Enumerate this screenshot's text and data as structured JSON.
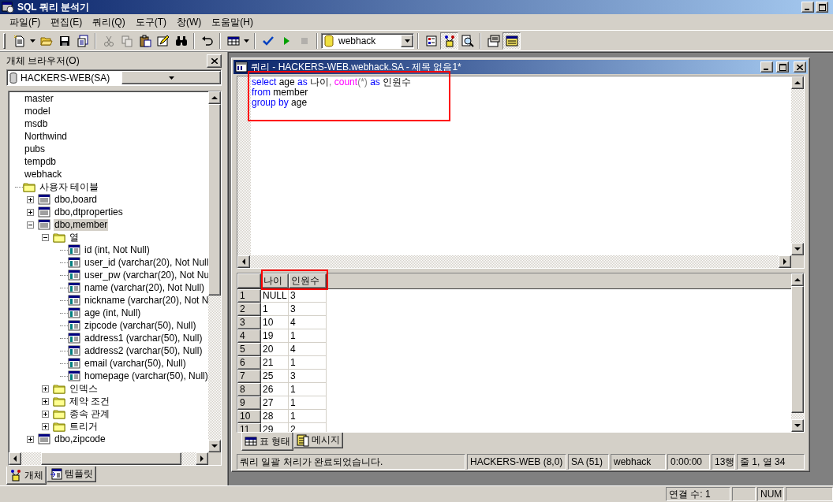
{
  "window": {
    "title": "SQL 쿼리 분석기"
  },
  "menu": [
    "파일(F)",
    "편집(E)",
    "쿼리(Q)",
    "도구(T)",
    "창(W)",
    "도움말(H)"
  ],
  "toolbar": {
    "groups": [
      [
        {
          "kind": "new-query",
          "disabled": false
        },
        {
          "kind": "caret",
          "disabled": false
        },
        {
          "kind": "open",
          "disabled": false
        },
        {
          "kind": "save",
          "disabled": false
        },
        {
          "kind": "load-script",
          "disabled": false
        }
      ],
      [
        {
          "kind": "cut",
          "disabled": true
        },
        {
          "kind": "copy",
          "disabled": true
        },
        {
          "kind": "paste",
          "disabled": false
        },
        {
          "kind": "template",
          "disabled": false
        },
        {
          "kind": "find",
          "disabled": false
        }
      ],
      [
        {
          "kind": "undo",
          "disabled": false
        }
      ],
      [
        {
          "kind": "grid",
          "disabled": false
        },
        {
          "kind": "caret",
          "disabled": false
        }
      ],
      [
        {
          "kind": "check",
          "disabled": false
        },
        {
          "kind": "play",
          "disabled": false
        },
        {
          "kind": "stop",
          "disabled": true
        }
      ],
      [
        {
          "kind": "database",
          "value": "webhack"
        }
      ],
      [
        {
          "kind": "object-search",
          "disabled": false,
          "pressed": false
        },
        {
          "kind": "object-browser",
          "disabled": false,
          "pressed": true
        },
        {
          "kind": "search",
          "disabled": false,
          "pressed": false
        }
      ],
      [
        {
          "kind": "options",
          "disabled": false,
          "pressed": false
        },
        {
          "kind": "results-pane",
          "disabled": false,
          "pressed": true
        }
      ]
    ]
  },
  "object_browser": {
    "title": "개체 브라우저(O)",
    "server": "HACKERS-WEB(SA)",
    "tree": [
      {
        "label": "master",
        "kind": "database",
        "selected": false
      },
      {
        "label": "model",
        "kind": "database",
        "selected": false
      },
      {
        "label": "msdb",
        "kind": "database",
        "selected": false
      },
      {
        "label": "Northwind",
        "kind": "database",
        "selected": false
      },
      {
        "label": "pubs",
        "kind": "database",
        "selected": false
      },
      {
        "label": "tempdb",
        "kind": "database",
        "selected": false
      },
      {
        "label": "webhack",
        "kind": "database",
        "selected": false,
        "children": [
          {
            "label": "사용자 테이블",
            "kind": "folder",
            "selected": false,
            "children": [
              {
                "label": "dbo,board",
                "kind": "table",
                "selected": false,
                "expanded": false
              },
              {
                "label": "dbo,dtproperties",
                "kind": "table",
                "selected": false,
                "expanded": false
              },
              {
                "label": "dbo,member",
                "kind": "table",
                "selected": true,
                "expanded": true,
                "children": [
                  {
                    "label": "열",
                    "kind": "folder",
                    "selected": false,
                    "expanded": true,
                    "children": [
                      {
                        "label": "id (int, Not Null)",
                        "kind": "column",
                        "selected": false
                      },
                      {
                        "label": "user_id (varchar(20), Not Null",
                        "kind": "column",
                        "selected": false
                      },
                      {
                        "label": "user_pw (varchar(20), Not Nu",
                        "kind": "column",
                        "selected": false
                      },
                      {
                        "label": "name (varchar(20), Not Null)",
                        "kind": "column",
                        "selected": false
                      },
                      {
                        "label": "nickname (varchar(20), Not N",
                        "kind": "column",
                        "selected": false
                      },
                      {
                        "label": "age (int, Null)",
                        "kind": "column",
                        "selected": false
                      },
                      {
                        "label": "zipcode (varchar(50), Null)",
                        "kind": "column",
                        "selected": false
                      },
                      {
                        "label": "address1 (varchar(50), Null)",
                        "kind": "column",
                        "selected": false
                      },
                      {
                        "label": "address2 (varchar(50), Null)",
                        "kind": "column",
                        "selected": false
                      },
                      {
                        "label": "email (varchar(50), Null)",
                        "kind": "column",
                        "selected": false
                      },
                      {
                        "label": "homepage (varchar(50), Null)",
                        "kind": "column",
                        "selected": false
                      }
                    ]
                  },
                  {
                    "label": "인덱스",
                    "kind": "folder",
                    "selected": false,
                    "expanded": false
                  },
                  {
                    "label": "제약 조건",
                    "kind": "folder",
                    "selected": false,
                    "expanded": false
                  },
                  {
                    "label": "종속 관계",
                    "kind": "folder",
                    "selected": false,
                    "expanded": false
                  },
                  {
                    "label": "트리거",
                    "kind": "folder",
                    "selected": false,
                    "expanded": false
                  }
                ]
              },
              {
                "label": "dbo,zipcode",
                "kind": "table",
                "selected": false,
                "expanded": false
              }
            ]
          }
        ]
      }
    ],
    "tabs": [
      {
        "label": "개체",
        "selected": true
      },
      {
        "label": "템플릿",
        "selected": false
      }
    ]
  },
  "query_window": {
    "title": "쿼리 - HACKERS-WEB.webhack.SA - 제목 없음1*",
    "editor": {
      "highlighted": true,
      "lines": [
        [
          {
            "text": "select",
            "kind": "keyword"
          },
          {
            "text": " age ",
            "kind": "plain"
          },
          {
            "text": "as",
            "kind": "keyword"
          },
          {
            "text": " 나이",
            "kind": "plain"
          },
          {
            "text": ",",
            "kind": "operator"
          },
          {
            "text": " count",
            "kind": "function"
          },
          {
            "text": "(*)",
            "kind": "operator"
          },
          {
            "text": " as",
            "kind": "keyword"
          },
          {
            "text": " 인원수",
            "kind": "plain"
          }
        ],
        [
          {
            "text": "from",
            "kind": "keyword"
          },
          {
            "text": " member",
            "kind": "plain"
          }
        ],
        [
          {
            "text": "group by",
            "kind": "keyword"
          },
          {
            "text": " age",
            "kind": "plain"
          }
        ]
      ]
    },
    "results": {
      "highlighted": true,
      "columns": [
        "나이",
        "인원수"
      ],
      "rows": [
        {
          "number": "1",
          "cells": [
            "NULL",
            "3"
          ]
        },
        {
          "number": "2",
          "cells": [
            "1",
            "3"
          ]
        },
        {
          "number": "3",
          "cells": [
            "10",
            "4"
          ]
        },
        {
          "number": "4",
          "cells": [
            "19",
            "1"
          ]
        },
        {
          "number": "5",
          "cells": [
            "20",
            "4"
          ]
        },
        {
          "number": "6",
          "cells": [
            "21",
            "1"
          ]
        },
        {
          "number": "7",
          "cells": [
            "25",
            "3"
          ]
        },
        {
          "number": "8",
          "cells": [
            "26",
            "1"
          ]
        },
        {
          "number": "9",
          "cells": [
            "27",
            "1"
          ]
        },
        {
          "number": "10",
          "cells": [
            "28",
            "1"
          ]
        },
        {
          "number": "11",
          "cells": [
            "29",
            "2"
          ]
        }
      ]
    },
    "result_tabs": [
      {
        "label": "표 형태",
        "selected": true
      },
      {
        "label": "메시지",
        "selected": false
      }
    ],
    "status": [
      "쿼리 일괄 처리가 완료되었습니다.",
      "HACKERS-WEB (8,0)",
      "SA (51)",
      "webhack",
      "0:00:00",
      "13행",
      "줄 1, 열 34"
    ]
  },
  "status_bar": {
    "connections": "연결 수: 1",
    "num": "NUM"
  }
}
